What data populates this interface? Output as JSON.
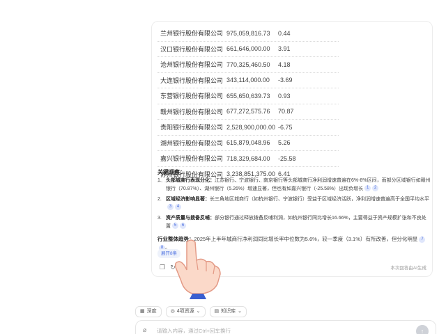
{
  "table": {
    "rows": [
      {
        "name": "兰州银行股份有限公司",
        "profit": "975,059,816.73",
        "growth": "0.44"
      },
      {
        "name": "汉口银行股份有限公司",
        "profit": "661,646,000.00",
        "growth": "3.91"
      },
      {
        "name": "沧州银行股份有限公司",
        "profit": "770,325,460.50",
        "growth": "4.18"
      },
      {
        "name": "大连银行股份有限公司",
        "profit": "343,114,000.00",
        "growth": "-3.69"
      },
      {
        "name": "东营银行股份有限公司",
        "profit": "655,650,639.73",
        "growth": "0.93"
      },
      {
        "name": "赣州银行股份有限公司",
        "profit": "677,272,575.76",
        "growth": "70.87"
      },
      {
        "name": "贵阳银行股份有限公司",
        "profit": "2,528,900,000.00",
        "growth": "-6.75"
      },
      {
        "name": "湖州银行股份有限公司",
        "profit": "615,879,048.96",
        "growth": "5.26"
      },
      {
        "name": "嘉兴银行股份有限公司",
        "profit": "718,329,684.00",
        "growth": "-25.58"
      },
      {
        "name": "苏州银行股份有限公司",
        "profit": "3,238,851,375.00",
        "growth": "6.41"
      }
    ]
  },
  "observations": {
    "title": "关键观察：",
    "items": [
      {
        "num": "1.",
        "label": "头部城商行表现分化：",
        "text": "江苏银行、宁波银行、南京银行等头部城商行净利润增速普遍在6%-8%区间，而部分区域银行如赣州银行（70.87%）、湖州银行（5.26%）增速显著，但也有如嘉兴银行（-25.58%）出现负增长",
        "cites": [
          "1",
          "2"
        ]
      },
      {
        "num": "2.",
        "label": "区域经济影响显著：",
        "text": "长三角地区城商行（如杭州银行、宁波银行）受益于区域经济活跃，净利润增速普遍高于全国平均水平",
        "cites": [
          "3",
          "4"
        ]
      },
      {
        "num": "3.",
        "label": "资产质量与拨备反哺：",
        "text": "部分银行通过释放拨备反哺利润，如杭州银行同比增长16.66%，主要得益于资产规模扩张和不良处置",
        "cites": [
          "5",
          "6"
        ]
      }
    ]
  },
  "trend": {
    "label": "行业整体趋势：",
    "text": "2025年上半年城商行净利润同比增长率中位数为5.6%，较一季度（3.1%）有所改善，但分化明显",
    "cites": [
      "7",
      "8"
    ]
  },
  "more_button": "展开8条",
  "generated_note": "本次回答由AI生成",
  "actions": {
    "copy_icon": "copy-icon",
    "regen_icon": "refresh-icon"
  },
  "chips": {
    "deep": "深度",
    "sources": "4项资源",
    "knowledge": "知识库"
  },
  "input": {
    "placeholder": "请输入内容，通过Ctrl+回车换行"
  },
  "colors": {
    "accent": "#4a6ee0",
    "cite_bg": "#dfe6fb"
  }
}
